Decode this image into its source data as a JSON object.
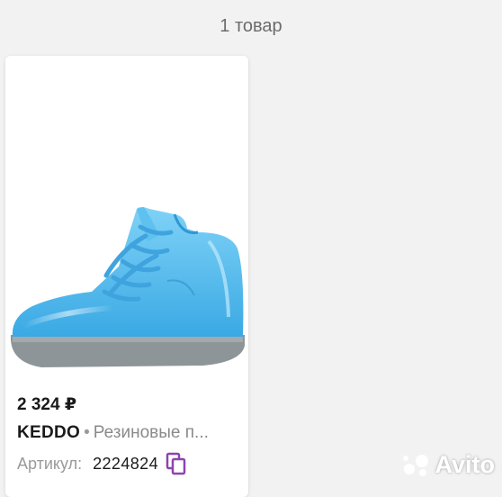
{
  "results": {
    "count_text": "1 товар"
  },
  "card": {
    "price": "2 324 ₽",
    "brand": "KEDDO",
    "separator": "•",
    "name": "Резиновые п...",
    "sku_label": "Артикул:",
    "sku_value": "2224824",
    "image_icon": "rain-boot-photo",
    "copy_icon": "copy-icon"
  },
  "watermark": {
    "text": "Avito"
  },
  "colors": {
    "background": "#f2f2f2",
    "boot": "#4fb8ec",
    "sole": "#8e9599",
    "copy_icon": "#8e44ad"
  }
}
